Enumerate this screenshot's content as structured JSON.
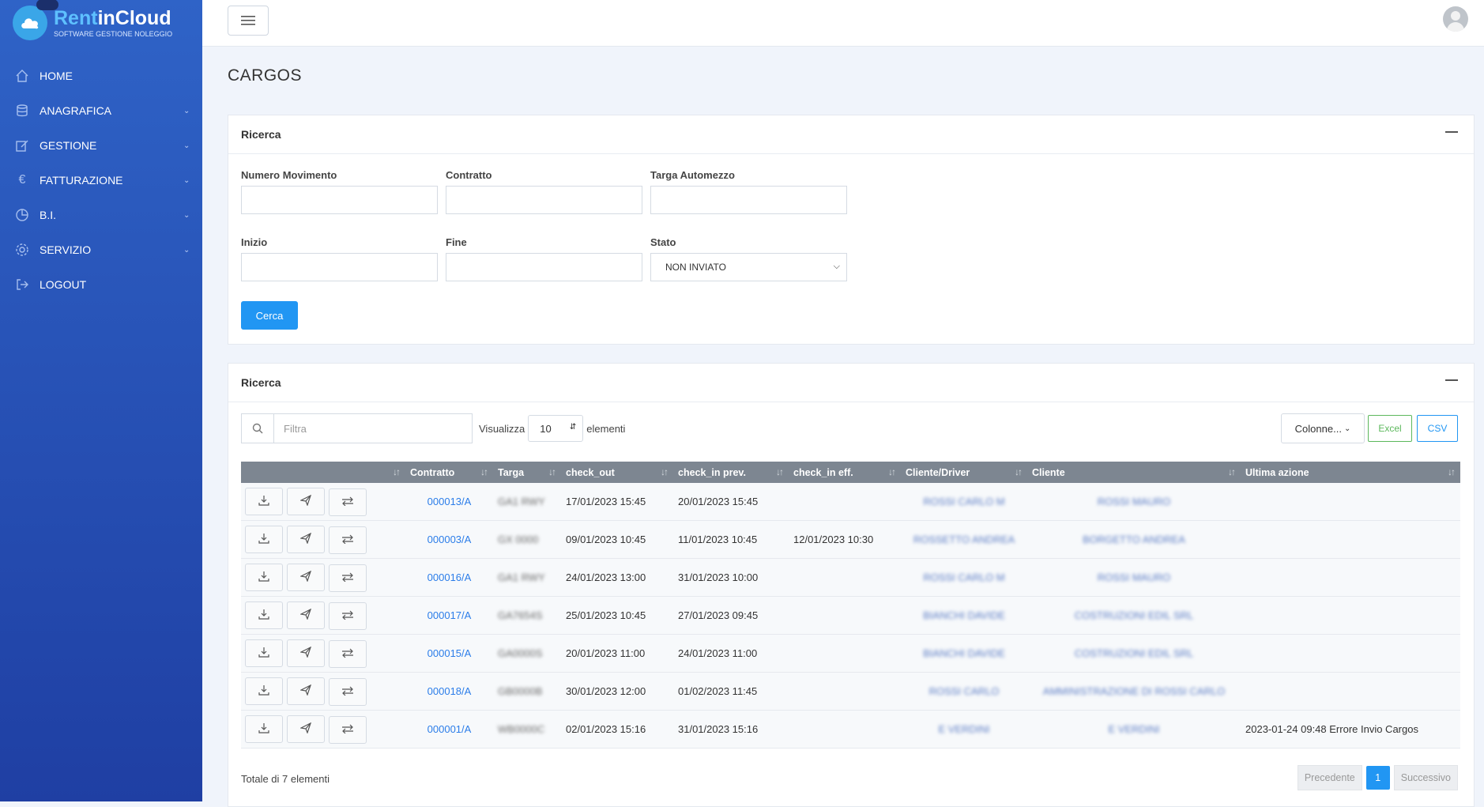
{
  "app": {
    "logo_rent": "Rent",
    "logo_cloud": "inCloud",
    "logo_sub": "SOFTWARE GESTIONE NOLEGGIO"
  },
  "sidebar": {
    "items": [
      {
        "label": "HOME",
        "icon": "home-icon"
      },
      {
        "label": "ANAGRAFICA",
        "icon": "database-icon"
      },
      {
        "label": "GESTIONE",
        "icon": "edit-icon"
      },
      {
        "label": "FATTURAZIONE",
        "icon": "euro-icon"
      },
      {
        "label": "B.I.",
        "icon": "pie-chart-icon"
      },
      {
        "label": "SERVIZIO",
        "icon": "gear-icon"
      },
      {
        "label": "LOGOUT",
        "icon": "logout-icon"
      }
    ]
  },
  "page": {
    "title": "CARGOS"
  },
  "search_card": {
    "title": "Ricerca",
    "numero_label": "Numero Movimento",
    "contratto_label": "Contratto",
    "targa_label": "Targa Automezzo",
    "inizio_label": "Inizio",
    "fine_label": "Fine",
    "stato_label": "Stato",
    "stato_value": "NON INVIATO",
    "cerca_label": "Cerca"
  },
  "results_card": {
    "title": "Ricerca",
    "filter_placeholder": "Filtra",
    "visualizza_label": "Visualizza",
    "page_size": "10",
    "elementi_label": "elementi",
    "colonne_label": "Colonne...",
    "excel_label": "Excel",
    "csv_label": "CSV",
    "columns": [
      "",
      "Contratto",
      "Targa",
      "check_out",
      "check_in prev.",
      "check_in eff.",
      "Cliente/Driver",
      "Cliente",
      "Ultima azione"
    ],
    "rows": [
      {
        "contratto": "000013/A",
        "targa": "GA1 RWY",
        "check_out": "17/01/2023 15:45",
        "check_in_prev": "20/01/2023 15:45",
        "check_in_eff": "",
        "driver": "ROSSI CARLO M",
        "cliente": "ROSSI MAURO",
        "ultima": ""
      },
      {
        "contratto": "000003/A",
        "targa": "GX 0000",
        "check_out": "09/01/2023 10:45",
        "check_in_prev": "11/01/2023 10:45",
        "check_in_eff": "12/01/2023 10:30",
        "driver": "ROSSETTO ANDREA",
        "cliente": "BORGETTO ANDREA",
        "ultima": ""
      },
      {
        "contratto": "000016/A",
        "targa": "GA1 RWY",
        "check_out": "24/01/2023 13:00",
        "check_in_prev": "31/01/2023 10:00",
        "check_in_eff": "",
        "driver": "ROSSI CARLO M",
        "cliente": "ROSSI MAURO",
        "ultima": ""
      },
      {
        "contratto": "000017/A",
        "targa": "GA7654S",
        "check_out": "25/01/2023 10:45",
        "check_in_prev": "27/01/2023 09:45",
        "check_in_eff": "",
        "driver": "BIANCHI DAVIDE",
        "cliente": "COSTRUZIONI EDIL SRL",
        "ultima": ""
      },
      {
        "contratto": "000015/A",
        "targa": "GA0000S",
        "check_out": "20/01/2023 11:00",
        "check_in_prev": "24/01/2023 11:00",
        "check_in_eff": "",
        "driver": "BIANCHI DAVIDE",
        "cliente": "COSTRUZIONI EDIL SRL",
        "ultima": ""
      },
      {
        "contratto": "000018/A",
        "targa": "GB0000B",
        "check_out": "30/01/2023 12:00",
        "check_in_prev": "01/02/2023 11:45",
        "check_in_eff": "",
        "driver": "ROSSI CARLO",
        "cliente": "AMMINISTRAZIONE DI ROSSI CARLO",
        "ultima": ""
      },
      {
        "contratto": "000001/A",
        "targa": "WB0000C",
        "check_out": "02/01/2023 15:16",
        "check_in_prev": "31/01/2023 15:16",
        "check_in_eff": "",
        "driver": "E VERDINI",
        "cliente": "E VERDINI",
        "ultima": "2023-01-24 09:48 Errore Invio Cargos"
      }
    ],
    "total_label": "Totale di 7 elementi",
    "prev_label": "Precedente",
    "current_page": "1",
    "next_label": "Successivo"
  }
}
